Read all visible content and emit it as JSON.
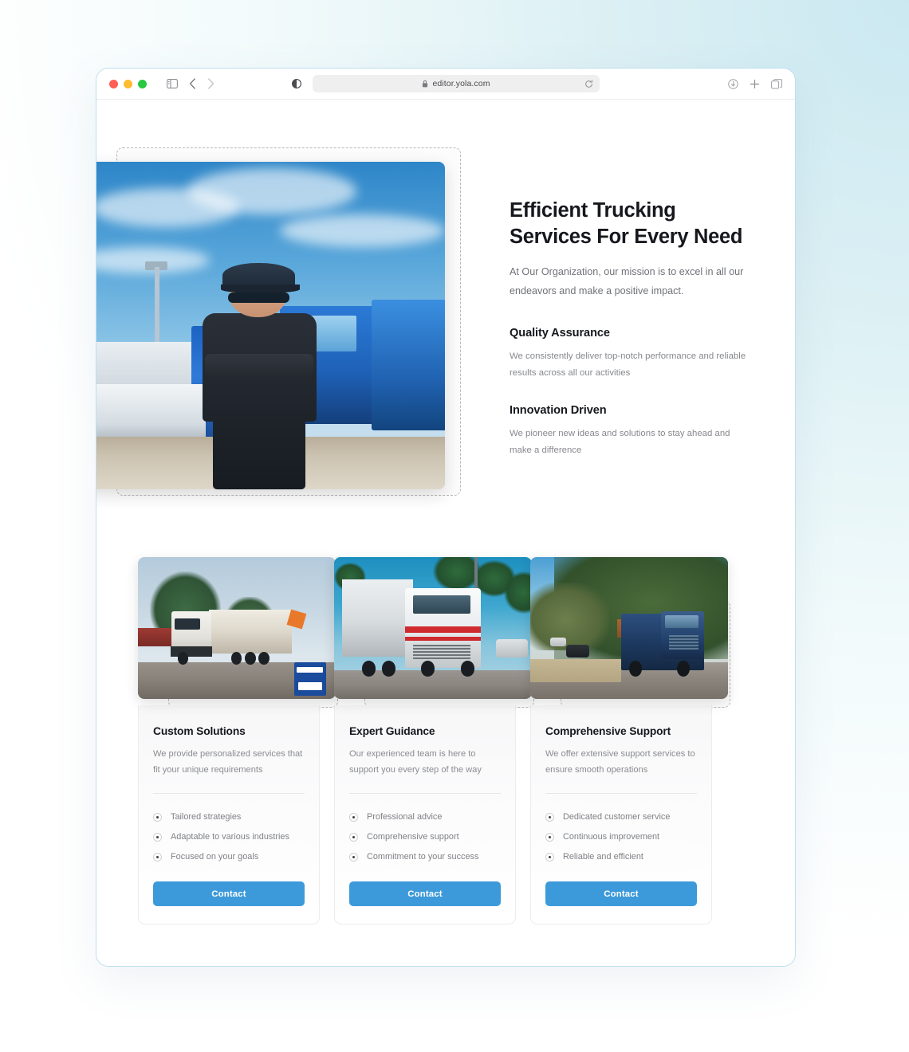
{
  "browser": {
    "url": "editor.yola.com",
    "traffic_lights": [
      "close",
      "minimize",
      "zoom"
    ],
    "icons": {
      "sidebar": "sidebar-toggle-icon",
      "back": "nav-back-icon",
      "forward": "nav-forward-icon",
      "reader": "reader-mode-icon",
      "lock": "lock-icon",
      "reload": "reload-icon",
      "download": "download-icon",
      "new_tab": "plus-icon",
      "tabs": "tab-overview-icon"
    }
  },
  "hero": {
    "title": "Efficient Trucking Services For Every Need",
    "subtitle": "At Our Organization, our mission is to excel in all our endeavors and make a positive impact.",
    "image_alt": "man-in-cap-and-sunglasses-in-front-of-blue-trucks",
    "features": [
      {
        "title": "Quality Assurance",
        "text": "We consistently deliver top-notch performance and reliable results across all our activities"
      },
      {
        "title": "Innovation Driven",
        "text": "We pioneer new ideas and solutions to stay ahead and make a difference"
      }
    ]
  },
  "cards": [
    {
      "title": "Custom Solutions",
      "desc": "We provide personalized services that fit your unique requirements",
      "items": [
        "Tailored strategies",
        "Adaptable to various industries",
        "Focused on your goals"
      ],
      "button": "Contact",
      "image_alt": "white-semi-truck-on-dirt-road"
    },
    {
      "title": "Expert Guidance",
      "desc": "Our experienced team is here to support you every step of the way",
      "items": [
        "Professional advice",
        "Comprehensive support",
        "Commitment to your success"
      ],
      "button": "Contact",
      "image_alt": "white-truck-with-red-stripe-and-palm-trees"
    },
    {
      "title": "Comprehensive Support",
      "desc": "We offer extensive support services to ensure smooth operations",
      "items": [
        "Dedicated customer service",
        "Continuous improvement",
        "Reliable and efficient"
      ],
      "button": "Contact",
      "image_alt": "blue-flatbed-truck-on-forest-road"
    }
  ],
  "colors": {
    "accent": "#3d9ada",
    "heading": "#16181d",
    "body_text": "#86888d",
    "window_border": "#bfdff0",
    "dashed_border": "#b9b9b9"
  }
}
